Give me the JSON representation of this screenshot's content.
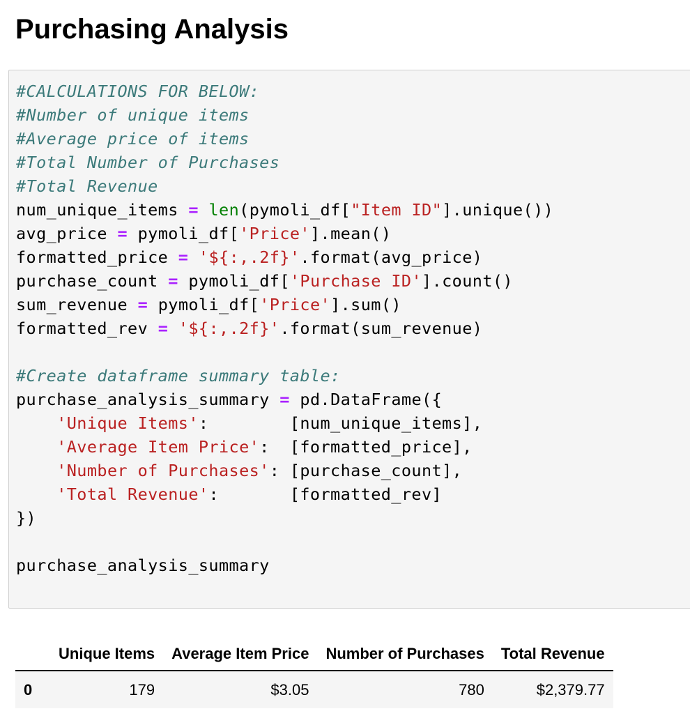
{
  "heading": "Purchasing Analysis",
  "code_cell": {
    "lines": [
      "#CALCULATIONS FOR BELOW:",
      "#Number of unique items",
      "#Average price of items",
      "#Total Number of Purchases",
      "#Total Revenue",
      "num_unique_items = len(pymoli_df[\"Item ID\"].unique())",
      "avg_price = pymoli_df['Price'].mean()",
      "formatted_price = '${:,.2f}'.format(avg_price)",
      "purchase_count = pymoli_df['Purchase ID'].count()",
      "sum_revenue = pymoli_df['Price'].sum()",
      "formatted_rev = '${:,.2f}'.format(sum_revenue)",
      "",
      "#Create dataframe summary table:",
      "purchase_analysis_summary = pd.DataFrame({",
      "    'Unique Items':        [num_unique_items],",
      "    'Average Item Price':  [formatted_price],",
      "    'Number of Purchases': [purchase_count],",
      "    'Total Revenue':       [formatted_rev]",
      "})",
      "",
      "purchase_analysis_summary"
    ]
  },
  "output_table": {
    "columns": [
      "",
      "Unique Items",
      "Average Item Price",
      "Number of Purchases",
      "Total Revenue"
    ],
    "rows": [
      {
        "index": "0",
        "values": [
          "179",
          "$3.05",
          "780",
          "$2,379.77"
        ]
      }
    ]
  },
  "colors": {
    "comment": "#3c7a7a",
    "operator": "#aa22ff",
    "builtin": "#008000",
    "string": "#ba2121",
    "cell_background": "#f5f5f5"
  }
}
